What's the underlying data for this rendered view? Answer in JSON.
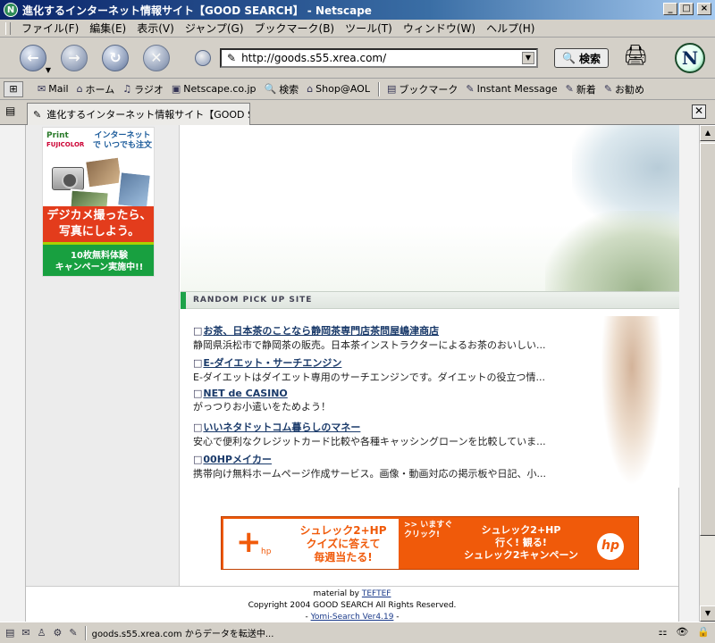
{
  "window": {
    "title": "進化するインターネット情報サイト【GOOD SEARCH】 - Netscape",
    "app_icon": "N",
    "minimize": "_",
    "maximize": "□",
    "close": "×"
  },
  "menu": [
    "ファイル(F)",
    "編集(E)",
    "表示(V)",
    "ジャンプ(G)",
    "ブックマーク(B)",
    "ツール(T)",
    "ウィンドウ(W)",
    "ヘルプ(H)"
  ],
  "nav": {
    "back_icon": "←",
    "forward_icon": "→",
    "reload_icon": "↻",
    "stop_icon": "✕",
    "url": "http://goods.s55.xrea.com/",
    "search_label": "検索",
    "search_icon": "🔍",
    "print_icon": "🖨",
    "logo": "N"
  },
  "personal_toolbar": [
    {
      "icon": "✉",
      "label": "Mail"
    },
    {
      "icon": "⌂",
      "label": "ホーム"
    },
    {
      "icon": "♫",
      "label": "ラジオ"
    },
    {
      "icon": "▣",
      "label": "Netscape.co.jp"
    },
    {
      "icon": "🔍",
      "label": "検索"
    },
    {
      "icon": "⌂",
      "label": "Shop@AOL"
    },
    {
      "icon": "▤",
      "label": "ブックマーク"
    },
    {
      "icon": "✎",
      "label": "Instant Message"
    },
    {
      "icon": "✎",
      "label": "新着"
    },
    {
      "icon": "✎",
      "label": "お勧め"
    }
  ],
  "tabs": {
    "active_title": "進化するインターネット情報サイト【GOOD SE...",
    "close": "✕"
  },
  "ad_fuji": {
    "brand": "Print",
    "brand_sub": "FUJICOLOR",
    "tagline": "インターネットで いつでも注文",
    "headline1": "デジカメ撮ったら、",
    "headline2": "写真にしよう。",
    "offer1": "10枚無料体験",
    "offer2": "キャンペーン実施中!!"
  },
  "random_pick": {
    "heading": "RANDOM PICK UP SITE",
    "sites": [
      {
        "name": "お茶、日本茶のことなら静岡茶専門店茶問屋嶋津商店",
        "desc": "静岡県浜松市で静岡茶の販売。日本茶インストラクターによるお茶のおいしい..."
      },
      {
        "name": "E-ダイエット・サーチエンジン",
        "desc": "E-ダイエットはダイエット専用のサーチエンジンです。ダイエットの役立つ情..."
      },
      {
        "name": "NET de CASINO",
        "desc": "がっつりお小遣いをためよう！"
      },
      {
        "name": "いいネタドットコム暮らしのマネー",
        "desc": "安心で便利なクレジットカード比較や各種キャッシングローンを比較していま..."
      },
      {
        "name": "00HPメイカー",
        "desc": "携帯向け無料ホームページ作成サービス。画像・動画対応の掲示板や日記、小..."
      }
    ]
  },
  "banner": {
    "plus": "+",
    "hp_small": "hp",
    "quiz_line1": "シュレック2+HP",
    "quiz_line2": "クイズに答えて",
    "quiz_line3": "毎週当たる!",
    "click_line1": ">> いますぐ",
    "click_line2": "クリック!",
    "campaign_line1": "シュレック2+HP",
    "campaign_line2": "行く! 観る!",
    "campaign_line3": "シュレック2キャンペーン",
    "hp_logo": "hp"
  },
  "footer": {
    "material_prefix": "material by ",
    "material_link": "TEFTEF",
    "copyright": "Copyright 2004 GOOD SEARCH All Rights Reserved.",
    "dash1": "- ",
    "yomi": "Yomi-Search Ver4.19",
    "dash2": " -"
  },
  "status": {
    "text": "goods.s55.xrea.com からデータを転送中...",
    "icons": [
      "▤",
      "✉",
      "♙",
      "⚙",
      "✎"
    ],
    "right_icons": [
      "⚏",
      "👁",
      "🔒"
    ]
  }
}
